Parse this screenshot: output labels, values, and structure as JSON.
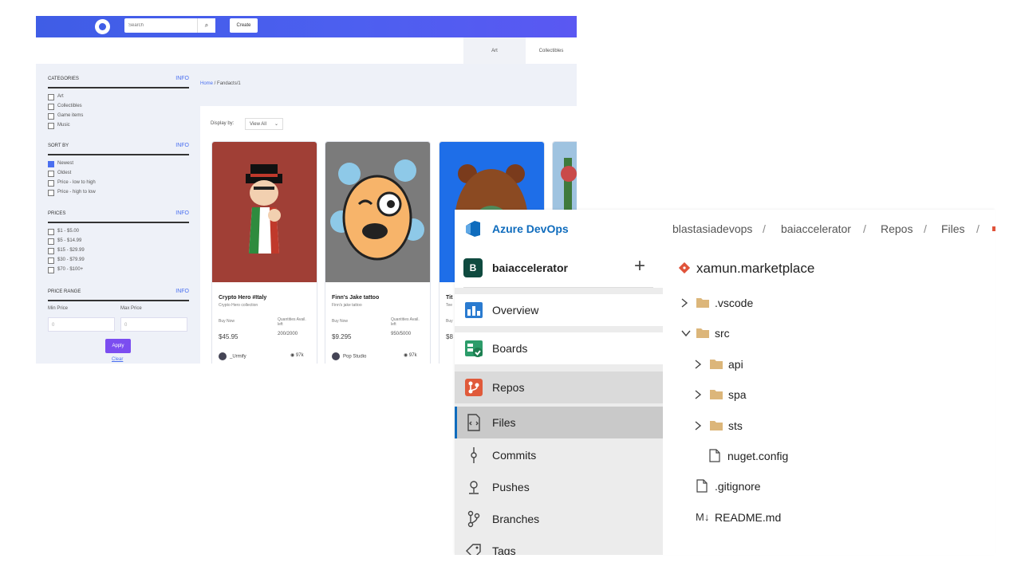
{
  "marketplace": {
    "search_placeholder": "Search",
    "create_label": "Create",
    "tabs": [
      "Art",
      "Collectibles"
    ],
    "breadcrumb": {
      "home": "Home",
      "current": "Fandacts/1"
    },
    "filters": [
      {
        "title": "CATEGORIES",
        "info": "INFO",
        "options": [
          {
            "label": "Art",
            "checked": false
          },
          {
            "label": "Collectibles",
            "checked": false
          },
          {
            "label": "Game items",
            "checked": false
          },
          {
            "label": "Music",
            "checked": false
          }
        ]
      },
      {
        "title": "SORT BY",
        "info": "INFO",
        "options": [
          {
            "label": "Newest",
            "checked": true
          },
          {
            "label": "Oldest",
            "checked": false
          },
          {
            "label": "Price - low to high",
            "checked": false
          },
          {
            "label": "Price - high to low",
            "checked": false
          }
        ]
      },
      {
        "title": "PRICES",
        "info": "INFO",
        "options": [
          {
            "label": "$1 - $5.00",
            "checked": false
          },
          {
            "label": "$5 - $14.99",
            "checked": false
          },
          {
            "label": "$15 - $29.99",
            "checked": false
          },
          {
            "label": "$30 - $79.99",
            "checked": false
          },
          {
            "label": "$70 - $100+",
            "checked": false
          }
        ]
      }
    ],
    "price_range": {
      "title": "PRICE RANGE",
      "info": "INFO",
      "min_label": "Min Price",
      "max_label": "Max Price",
      "min_placeholder": "0",
      "max_placeholder": "0"
    },
    "apply_label": "Apply",
    "clear_label": "Clear",
    "display_label": "Display by:",
    "view_all_label": "View All",
    "cards": [
      {
        "name": "Crypto Hero #Italy",
        "collection": "Crypto Hero collection",
        "buy_label": "Buy Now",
        "price": "$45.95",
        "qty_label": "Quantities Avail. left",
        "qty": "200/2000",
        "owner": "_Urmify",
        "views": "97k"
      },
      {
        "name": "Finn's Jake tattoo",
        "collection": "Finn's jake tattoo",
        "buy_label": "Buy Now",
        "price": "$9.295",
        "qty_label": "Quantities Avail. left",
        "qty": "950/5000",
        "owner": "Pop Studio",
        "views": "97k"
      },
      {
        "name": "Tit",
        "collection": "Tee",
        "buy_label": "Buy",
        "price": "$8",
        "qty_label": "",
        "qty": "",
        "owner": "",
        "views": ""
      }
    ]
  },
  "ado": {
    "brand": "Azure DevOps",
    "breadcrumb": [
      "blastasiadevops",
      "baiaccelerator",
      "Repos",
      "Files"
    ],
    "project": {
      "initial": "B",
      "name": "baiaccelerator",
      "add_icon": "+"
    },
    "nav": [
      {
        "label": "Overview",
        "icon": "overview-icon"
      },
      {
        "label": "Boards",
        "icon": "boards-icon"
      },
      {
        "label": "Repos",
        "icon": "repos-icon"
      },
      {
        "label": "Files",
        "icon": "files-icon"
      },
      {
        "label": "Commits",
        "icon": "commits-icon"
      },
      {
        "label": "Pushes",
        "icon": "pushes-icon"
      },
      {
        "label": "Branches",
        "icon": "branches-icon"
      },
      {
        "label": "Tags",
        "icon": "tags-icon"
      }
    ],
    "repo_name": "xamun.marketplace",
    "tree": [
      {
        "name": ".vscode",
        "kind": "folder",
        "expanded": false,
        "level": 0
      },
      {
        "name": "src",
        "kind": "folder",
        "expanded": true,
        "level": 0
      },
      {
        "name": "api",
        "kind": "folder",
        "expanded": false,
        "level": 1
      },
      {
        "name": "spa",
        "kind": "folder",
        "expanded": false,
        "level": 1
      },
      {
        "name": "sts",
        "kind": "folder",
        "expanded": false,
        "level": 1
      },
      {
        "name": "nuget.config",
        "kind": "file",
        "level": 1
      },
      {
        "name": ".gitignore",
        "kind": "file",
        "level": 0
      },
      {
        "name": "README.md",
        "kind": "markdown",
        "level": 0
      }
    ],
    "colors": {
      "brand": "#0f6cbd",
      "folder": "#dcb67a",
      "repos": "#e05a3a",
      "git": "#e0533a"
    }
  }
}
